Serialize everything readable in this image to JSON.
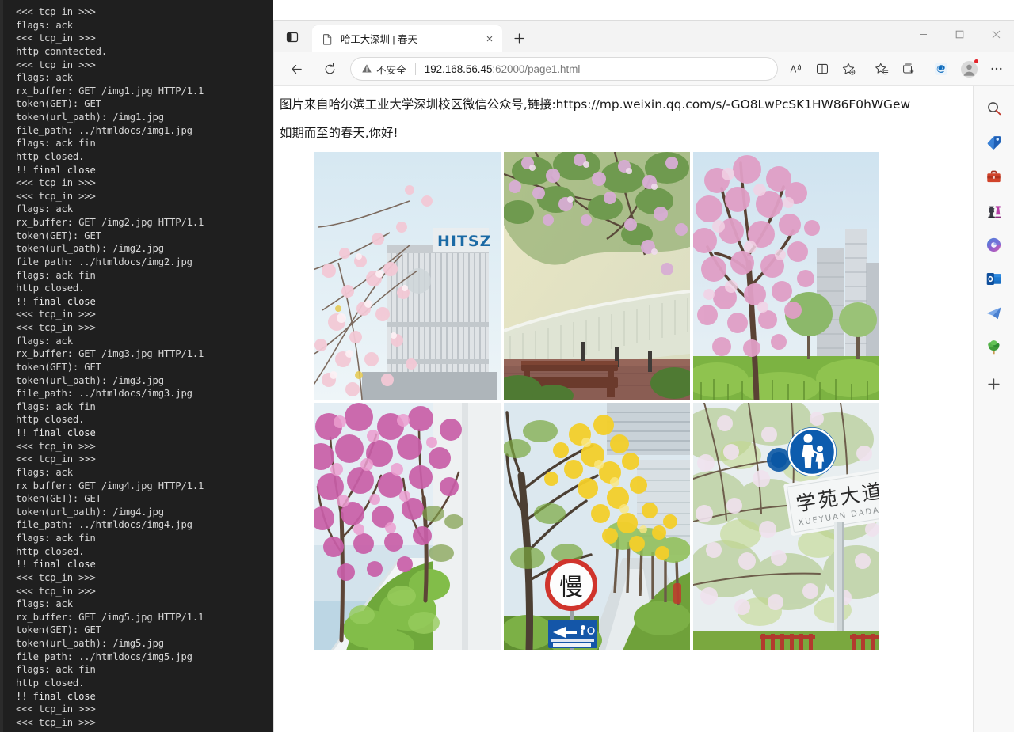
{
  "terminal": {
    "lines": [
      "<<< tcp_in >>>",
      "flags: ack",
      "<<< tcp_in >>>",
      "http conntected.",
      "<<< tcp_in >>>",
      "flags: ack",
      "rx_buffer: GET /img1.jpg HTTP/1.1",
      "token(GET): GET",
      "token(url_path): /img1.jpg",
      "file_path: ../htmldocs/img1.jpg",
      "flags: ack fin",
      "http closed.",
      "!! final close",
      "<<< tcp_in >>>",
      "<<< tcp_in >>>",
      "flags: ack",
      "rx_buffer: GET /img2.jpg HTTP/1.1",
      "token(GET): GET",
      "token(url_path): /img2.jpg",
      "file_path: ../htmldocs/img2.jpg",
      "flags: ack fin",
      "http closed.",
      "!! final close",
      "<<< tcp_in >>>",
      "<<< tcp_in >>>",
      "flags: ack",
      "rx_buffer: GET /img3.jpg HTTP/1.1",
      "token(GET): GET",
      "token(url_path): /img3.jpg",
      "file_path: ../htmldocs/img3.jpg",
      "flags: ack fin",
      "http closed.",
      "!! final close",
      "<<< tcp_in >>>",
      "<<< tcp_in >>>",
      "flags: ack",
      "rx_buffer: GET /img4.jpg HTTP/1.1",
      "token(GET): GET",
      "token(url_path): /img4.jpg",
      "file_path: ../htmldocs/img4.jpg",
      "flags: ack fin",
      "http closed.",
      "!! final close",
      "<<< tcp_in >>>",
      "<<< tcp_in >>>",
      "flags: ack",
      "rx_buffer: GET /img5.jpg HTTP/1.1",
      "token(GET): GET",
      "token(url_path): /img5.jpg",
      "file_path: ../htmldocs/img5.jpg",
      "flags: ack fin",
      "http closed.",
      "!! final close",
      "<<< tcp_in >>>",
      "<<< tcp_in >>>"
    ]
  },
  "browser": {
    "tab_actions_icon": "vertical-tabs-icon",
    "tab": {
      "favicon": "document-icon",
      "title": "哈工大深圳 | 春天",
      "close_label": "×"
    },
    "new_tab_label": "+",
    "window_controls": {
      "minimize": "—",
      "maximize": "□",
      "close": "×"
    },
    "toolbar": {
      "back_icon": "back-arrow-icon",
      "refresh_icon": "refresh-icon",
      "security_label": "不安全",
      "url_host": "192.168.56.45",
      "url_path": ":62000/page1.html",
      "url_full": "192.168.56.45:62000/page1.html",
      "right_icons": [
        {
          "name": "read-aloud-icon",
          "label": "A"
        },
        {
          "name": "split-screen-icon",
          "label": ""
        },
        {
          "name": "add-favorite-icon",
          "label": ""
        },
        {
          "name": "favorites-icon",
          "label": ""
        },
        {
          "name": "collections-icon",
          "label": ""
        },
        {
          "name": "copilot-icon",
          "label": "e"
        },
        {
          "name": "profile-avatar",
          "label": ""
        },
        {
          "name": "settings-more-icon",
          "label": "⋯"
        }
      ]
    },
    "sidebar": {
      "items": [
        {
          "name": "search-icon",
          "label": "搜索"
        },
        {
          "name": "shopping-tag-icon",
          "label": "购物"
        },
        {
          "name": "tools-briefcase-icon",
          "label": "工具"
        },
        {
          "name": "games-icon",
          "label": "游戏"
        },
        {
          "name": "copilot-icon",
          "label": "Copilot"
        },
        {
          "name": "outlook-icon",
          "label": "Outlook"
        },
        {
          "name": "telegram-icon",
          "label": "Telegram"
        },
        {
          "name": "tree-icon",
          "label": "Tree"
        },
        {
          "name": "add-sidebar-app-icon",
          "label": "+"
        }
      ]
    }
  },
  "page": {
    "paragraph_1": "图片来自哈尔滨工业大学深圳校区微信公众号,链接:https://mp.weixin.qq.com/s/-GO8LwPcSK1HW86F0hWGew",
    "paragraph_2": "如期而至的春天,你好!",
    "images": [
      {
        "file": "img1.jpg",
        "alt": "HITSZ 教学楼与樱花"
      },
      {
        "file": "img2.jpg",
        "alt": "紫荆花树下的长椅"
      },
      {
        "file": "img3.jpg",
        "alt": "粉色紫荆与高楼"
      },
      {
        "file": "img4.jpg",
        "alt": "步道旁的紫红花树"
      },
      {
        "file": "img5.jpg",
        "alt": "黄风铃木与慢行标志"
      },
      {
        "file": "img6.jpg",
        "alt": "学苑大道路牌"
      }
    ]
  },
  "colors": {
    "terminal_bg": "#1f1f1f",
    "terminal_fg": "#d6d6d6",
    "chrome_bg": "#f3f3f3",
    "toolbar_bg": "#f8f8f8",
    "accent": "#0f6cbd",
    "badge_red": "#e3242b"
  }
}
